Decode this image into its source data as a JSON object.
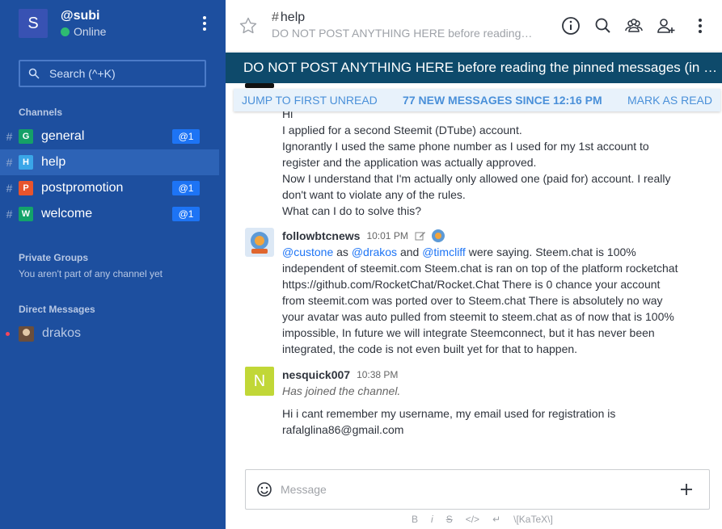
{
  "user": {
    "initial": "S",
    "name": "@subi",
    "status": "Online"
  },
  "search": {
    "label": "Search (^+K)"
  },
  "sidebar": {
    "channels_title": "Channels",
    "channels": [
      {
        "initial": "G",
        "name": "general",
        "badge": "@1",
        "color": "#15a067"
      },
      {
        "initial": "H",
        "name": "help",
        "badge": "",
        "color": "#3aa6e8"
      },
      {
        "initial": "P",
        "name": "postpromotion",
        "badge": "@1",
        "color": "#e8542d"
      },
      {
        "initial": "W",
        "name": "welcome",
        "badge": "@1",
        "color": "#13a36a"
      }
    ],
    "private_title": "Private Groups",
    "private_note": "You aren't part of any channel yet",
    "direct_title": "Direct Messages",
    "direct": [
      {
        "name": "drakos"
      }
    ]
  },
  "room": {
    "hash": "#",
    "name": "help",
    "topic": "DO NOT POST ANYTHING HERE before reading…",
    "announcement": "DO NOT POST ANYTHING HERE before reading the pinned messages (in …"
  },
  "unread": {
    "jump": "JUMP TO FIRST UNREAD",
    "count": "77 NEW MESSAGES SINCE 12:16 PM",
    "mark": "MARK AS READ"
  },
  "messages": [
    {
      "lines": [
        "Hi",
        "I applied for a second Steemit (DTube) account.",
        "Ignorantly I used the same phone number as I used for my 1st account to",
        "register and the application was actually approved.",
        "Now I understand that I'm actually only allowed one (paid for) account. I really",
        "don't want to violate any of the rules.",
        "What can I do to solve this?"
      ]
    },
    {
      "user": "followbtcnews",
      "time": "10:01 PM",
      "mention1": "@custone",
      "as": " as ",
      "mention2": "@drakos",
      "and": " and ",
      "mention3": "@timcliff",
      "rest_first": " were saying. Steem.chat is 100%",
      "lines": [
        "independent of steemit.com Steem.chat is ran on top of the platform rocketchat",
        "https://github.com/RocketChat/Rocket.Chat There is 0 chance your account",
        "from steemit.com was ported over to Steem.chat There is absolutely no way",
        "your avatar was auto pulled from steemit to steem.chat as of now that is 100%",
        "impossible, In future we will integrate Steemconnect, but it has never been",
        "integrated, the code is not even built yet for that to happen."
      ]
    },
    {
      "initial": "N",
      "user": "nesquick007",
      "time": "10:38 PM",
      "system": "Has joined the channel.",
      "lines": [
        "Hi i cant remember my username, my email used for registration is",
        "rafalglina86@gmail.com"
      ]
    }
  ],
  "composer": {
    "placeholder": "Message"
  },
  "format": {
    "bold": "B",
    "italic": "i",
    "strike": "S",
    "code": "</>",
    "katex": "\\[KaTeX\\]"
  }
}
